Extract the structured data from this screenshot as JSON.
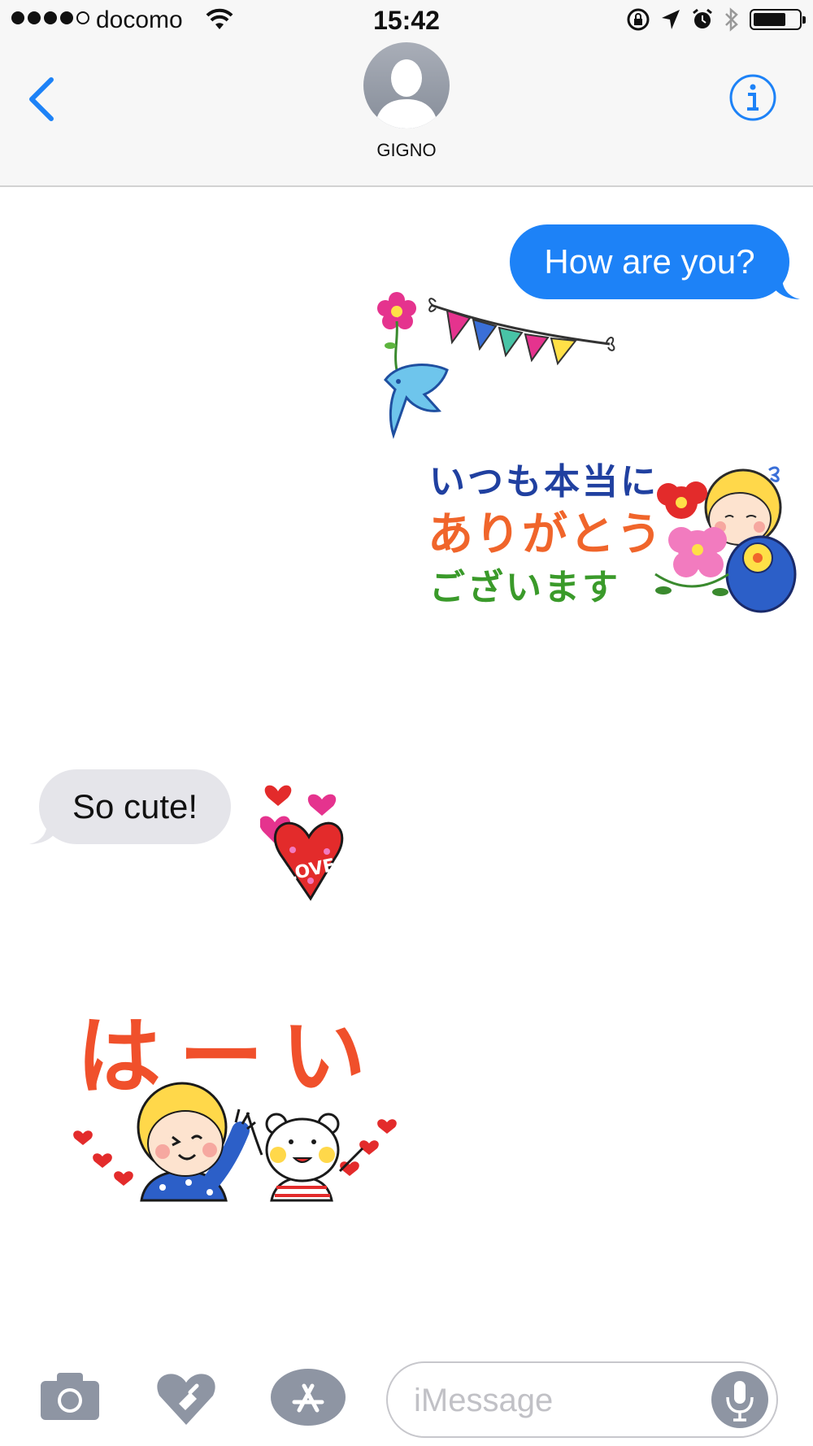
{
  "status_bar": {
    "carrier": "docomo",
    "time": "15:42",
    "signal_dots_filled": 4,
    "signal_dots_total": 5,
    "icons": [
      "wifi-icon",
      "rotation-lock-icon",
      "location-arrow-icon",
      "alarm-icon",
      "bluetooth-icon",
      "battery-icon"
    ]
  },
  "header": {
    "back_icon": "chevron-left-icon",
    "contact_name": "GIGNO",
    "info_icon": "info-icon",
    "accent_color": "#1d82f7"
  },
  "messages": [
    {
      "direction": "sent",
      "type": "text",
      "text": "How are you?",
      "color": "#1d82f7"
    },
    {
      "direction": "sent",
      "type": "sticker",
      "name": "bird-flower-bunting-sticker"
    },
    {
      "direction": "sent",
      "type": "sticker",
      "name": "thank-you-sticker",
      "lines": [
        "いつも本当に",
        "ありがとう",
        "ございます"
      ]
    },
    {
      "direction": "received",
      "type": "text",
      "text": "So cute!",
      "color": "#e5e5ea"
    },
    {
      "direction": "received",
      "type": "sticker",
      "name": "love-heart-sticker",
      "text": "LOVE"
    },
    {
      "direction": "received",
      "type": "sticker",
      "name": "haai-sticker",
      "text": "はーい"
    }
  ],
  "input_bar": {
    "buttons": [
      "camera-icon",
      "digital-touch-icon",
      "app-store-icon"
    ],
    "placeholder": "iMessage",
    "mic_icon": "microphone-icon"
  }
}
